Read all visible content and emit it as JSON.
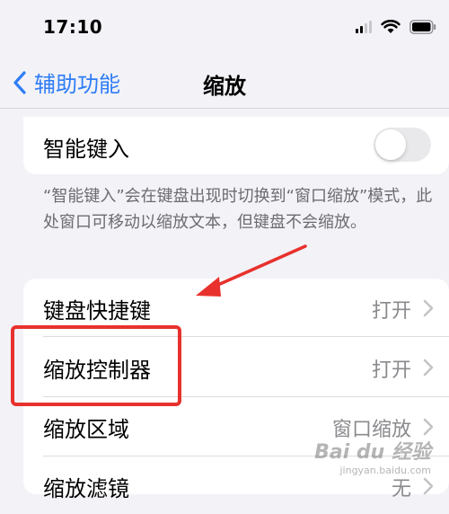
{
  "status_bar": {
    "time": "17:10"
  },
  "nav": {
    "back_label": "辅助功能",
    "title": "缩放"
  },
  "group1": {
    "label": "智能键入",
    "toggle_on": false,
    "footnote": "“智能键入”会在键盘出现时切换到“窗口缩放”模式，此处窗口可移动以缩放文本，但键盘不会缩放。"
  },
  "group2": {
    "rows": [
      {
        "label": "键盘快捷键",
        "value": "打开"
      },
      {
        "label": "缩放控制器",
        "value": "打开"
      },
      {
        "label": "缩放区域",
        "value": "窗口缩放"
      },
      {
        "label": "缩放滤镜",
        "value": "无"
      }
    ]
  },
  "annotation": {
    "color": "#e8312c"
  },
  "watermark": {
    "main": "Bai du 经验",
    "sub": "jingyan.baidu.com"
  },
  "colors": {
    "accent": "#2f7cf6",
    "background": "#f2f2f7",
    "secondary_text": "#8a8a8e"
  }
}
